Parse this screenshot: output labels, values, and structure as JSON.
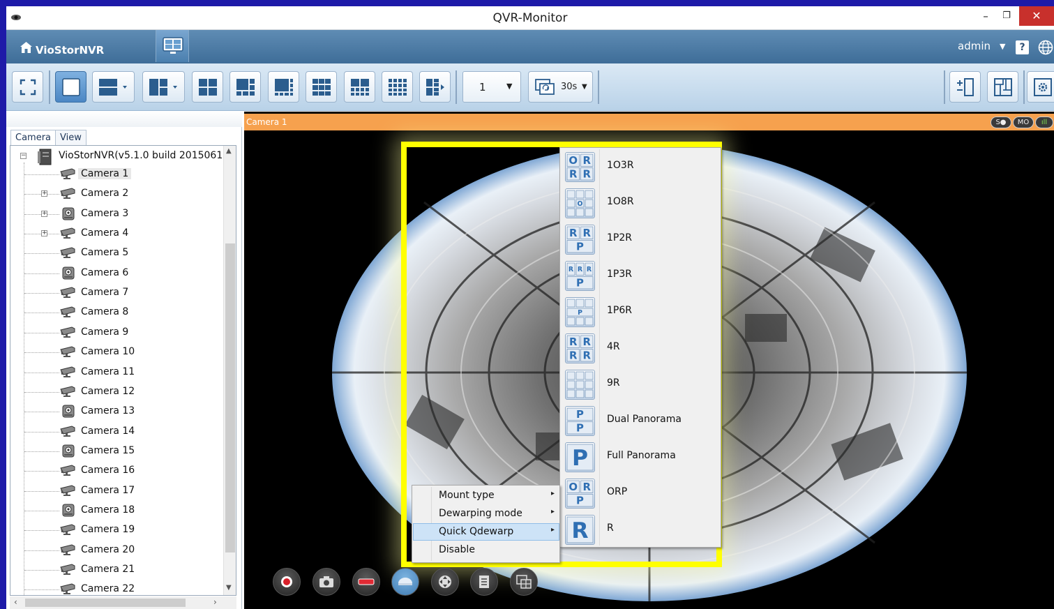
{
  "window": {
    "title": "QVR-Monitor",
    "minimize": "–",
    "maximize": "❐",
    "close": "✕"
  },
  "header": {
    "brand": "VioStorNVR",
    "user": "admin",
    "user_caret": "▼",
    "help": "?"
  },
  "toolbar": {
    "sequence_value": "1",
    "sequence_caret": "▼",
    "interval_value": "30s",
    "interval_caret": "▼"
  },
  "panel": {
    "tabs": [
      "Camera",
      "View"
    ],
    "root_label": "VioStorNVR(v5.1.0 build 2015061(",
    "cameras": [
      {
        "label": "Camera 1",
        "icon": "bullet-camera-icon",
        "expandable": false,
        "selected": true
      },
      {
        "label": "Camera 2",
        "icon": "bullet-camera-icon",
        "expandable": true
      },
      {
        "label": "Camera 3",
        "icon": "dome-camera-icon",
        "expandable": true
      },
      {
        "label": "Camera 4",
        "icon": "bullet-camera-icon",
        "expandable": true
      },
      {
        "label": "Camera 5",
        "icon": "bullet-camera-icon",
        "expandable": false
      },
      {
        "label": "Camera 6",
        "icon": "dome-camera-icon",
        "expandable": false
      },
      {
        "label": "Camera 7",
        "icon": "bullet-camera-icon",
        "expandable": false
      },
      {
        "label": "Camera 8",
        "icon": "bullet-camera-icon",
        "expandable": false
      },
      {
        "label": "Camera 9",
        "icon": "bullet-camera-icon",
        "expandable": false
      },
      {
        "label": "Camera 10",
        "icon": "bullet-camera-icon",
        "expandable": false
      },
      {
        "label": "Camera 11",
        "icon": "bullet-camera-icon",
        "expandable": false
      },
      {
        "label": "Camera 12",
        "icon": "bullet-camera-icon",
        "expandable": false
      },
      {
        "label": "Camera 13",
        "icon": "dome-camera-icon",
        "expandable": false
      },
      {
        "label": "Camera 14",
        "icon": "bullet-camera-icon",
        "expandable": false
      },
      {
        "label": "Camera 15",
        "icon": "dome-camera-icon",
        "expandable": false
      },
      {
        "label": "Camera 16",
        "icon": "bullet-camera-icon",
        "expandable": false
      },
      {
        "label": "Camera 17",
        "icon": "bullet-camera-icon",
        "expandable": false
      },
      {
        "label": "Camera 18",
        "icon": "dome-camera-icon",
        "expandable": false
      },
      {
        "label": "Camera 19",
        "icon": "bullet-camera-icon",
        "expandable": false
      },
      {
        "label": "Camera 20",
        "icon": "bullet-camera-icon",
        "expandable": false
      },
      {
        "label": "Camera 21",
        "icon": "bullet-camera-icon",
        "expandable": false
      },
      {
        "label": "Camera 22",
        "icon": "bullet-camera-icon",
        "expandable": false
      }
    ]
  },
  "video": {
    "camera_label": "Camera 1",
    "status": [
      "S●",
      "MO",
      "ıll"
    ]
  },
  "context_menu": {
    "items": [
      {
        "label": "Mount type",
        "has_submenu": true
      },
      {
        "label": "Dewarping mode",
        "has_submenu": true
      },
      {
        "label": "Quick Qdewarp",
        "has_submenu": true,
        "highlighted": true
      },
      {
        "label": "Disable",
        "has_submenu": false
      }
    ],
    "arrow": "▸"
  },
  "submenu": {
    "items": [
      {
        "label": "1O3R",
        "icon_grid": [
          [
            "O",
            "R"
          ],
          [
            "R",
            "R"
          ]
        ]
      },
      {
        "label": "1O8R",
        "icon_grid": [
          [
            "",
            "",
            ""
          ],
          [
            "",
            "O",
            ""
          ],
          [
            "",
            "",
            ""
          ]
        ]
      },
      {
        "label": "1P2R",
        "icon_grid": [
          [
            "R",
            "R"
          ],
          [
            "P"
          ]
        ]
      },
      {
        "label": "1P3R",
        "icon_grid": [
          [
            "R",
            "R",
            "R"
          ],
          [
            "P"
          ]
        ]
      },
      {
        "label": "1P6R",
        "icon_grid": [
          [
            "",
            "",
            ""
          ],
          [
            "P"
          ],
          [
            "",
            "",
            ""
          ]
        ]
      },
      {
        "label": "4R",
        "icon_grid": [
          [
            "R",
            "R"
          ],
          [
            "R",
            "R"
          ]
        ]
      },
      {
        "label": "9R",
        "icon_grid": [
          [
            "",
            "",
            ""
          ],
          [
            "",
            "",
            ""
          ],
          [
            "",
            "",
            ""
          ]
        ]
      },
      {
        "label": "Dual Panorama",
        "icon_grid": [
          [
            "P"
          ],
          [
            "P"
          ]
        ]
      },
      {
        "label": "Full Panorama",
        "icon_grid": [
          [
            "P"
          ]
        ]
      },
      {
        "label": "ORP",
        "icon_grid": [
          [
            "O",
            "R"
          ],
          [
            "P"
          ]
        ]
      },
      {
        "label": "R",
        "icon_grid": [
          [
            "R"
          ]
        ]
      }
    ]
  },
  "colors": {
    "border": "#1e1aa8",
    "header": "#4a78a3",
    "camera_bar": "#f6a14e",
    "highlight": "#ffff00",
    "menu_hover": "#cde3f7",
    "submenu_icon_text": "#2f6fb3"
  }
}
